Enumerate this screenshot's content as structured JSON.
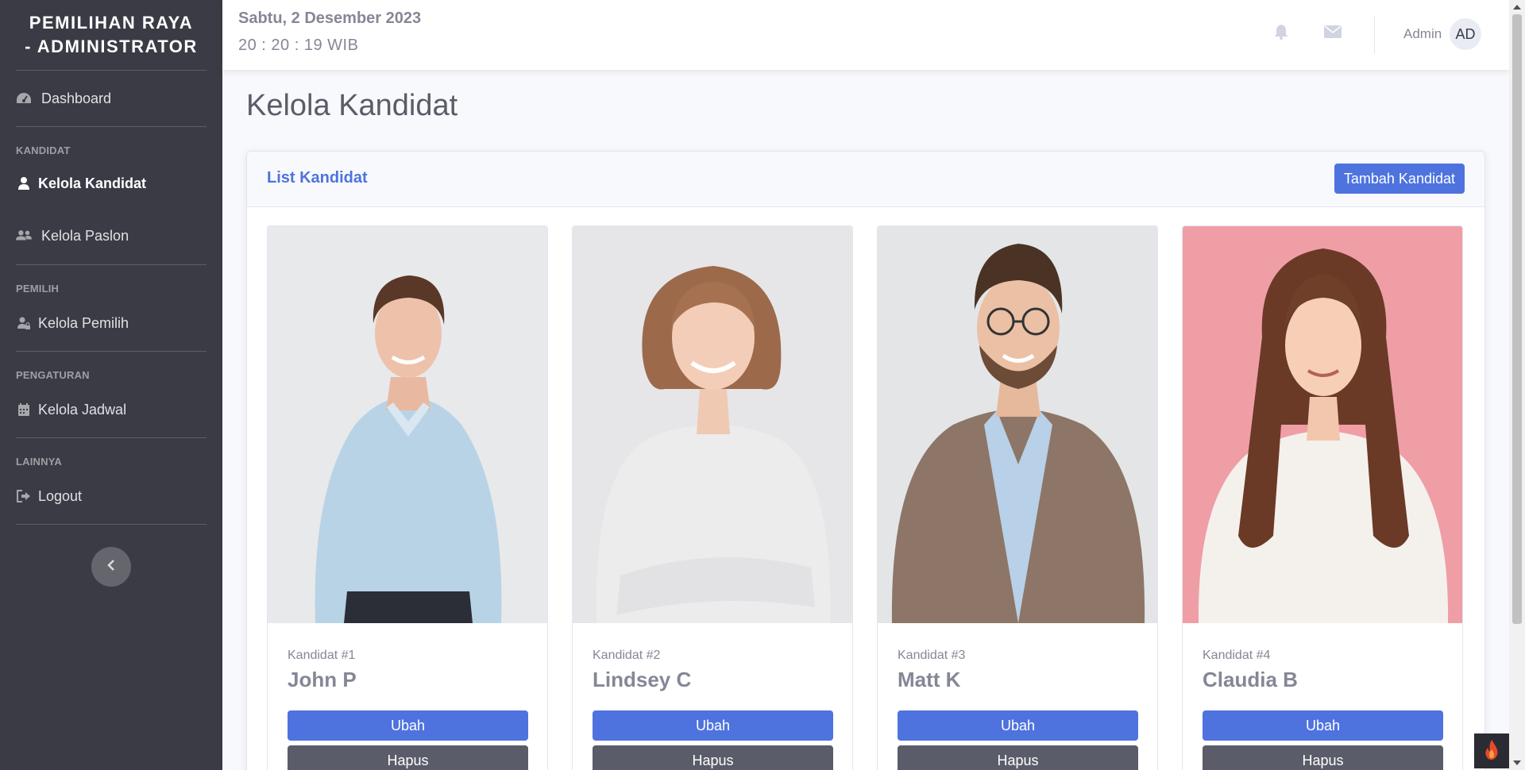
{
  "sidebar": {
    "brand": "PEMILIHAN RAYA - ADMINISTRATOR",
    "items": [
      {
        "label": "Dashboard",
        "icon": "dashboard-icon"
      },
      {
        "heading": "KANDIDAT"
      },
      {
        "label": "Kelola Kandidat",
        "icon": "user-icon",
        "active": true
      },
      {
        "label": "Kelola Paslon",
        "icon": "users-icon"
      },
      {
        "heading": "PEMILIH"
      },
      {
        "label": "Kelola Pemilih",
        "icon": "user-lock-icon"
      },
      {
        "heading": "PENGATURAN"
      },
      {
        "label": "Kelola Jadwal",
        "icon": "calendar-icon"
      },
      {
        "heading": "LAINNYA"
      },
      {
        "label": "Logout",
        "icon": "logout-icon"
      }
    ],
    "headings": {
      "kandidat": "KANDIDAT",
      "pemilih": "PEMILIH",
      "pengaturan": "PENGATURAN",
      "lainnya": "LAINNYA"
    },
    "labels": {
      "dashboard": "Dashboard",
      "kelola_kandidat": "Kelola Kandidat",
      "kelola_paslon": "Kelola Paslon",
      "kelola_pemilih": "Kelola Pemilih",
      "kelola_jadwal": "Kelola Jadwal",
      "logout": "Logout"
    },
    "brand_line1": "PEMILIHAN RAYA",
    "brand_line2": "- ADMINISTRATOR"
  },
  "topbar": {
    "date": "Sabtu, 2 Desember 2023",
    "time": "20 : 20 : 19 WIB",
    "user_name": "Admin",
    "avatar_initials": "AD"
  },
  "main": {
    "page_title": "Kelola Kandidat",
    "card_title": "List Kandidat",
    "add_button": "Tambah Kandidat",
    "candidates": [
      {
        "label": "Kandidat #1",
        "name": "John P",
        "edit": "Ubah",
        "delete": "Hapus"
      },
      {
        "label": "Kandidat #2",
        "name": "Lindsey C",
        "edit": "Ubah",
        "delete": "Hapus"
      },
      {
        "label": "Kandidat #3",
        "name": "Matt K",
        "edit": "Ubah",
        "delete": "Hapus"
      },
      {
        "label": "Kandidat #4",
        "name": "Claudia B",
        "edit": "Ubah",
        "delete": "Hapus"
      }
    ]
  },
  "colors": {
    "primary": "#4e73df",
    "sidebar": "#3a3b45",
    "secondary": "#5a5c69",
    "photo4_bg": "#ef9ea6"
  }
}
